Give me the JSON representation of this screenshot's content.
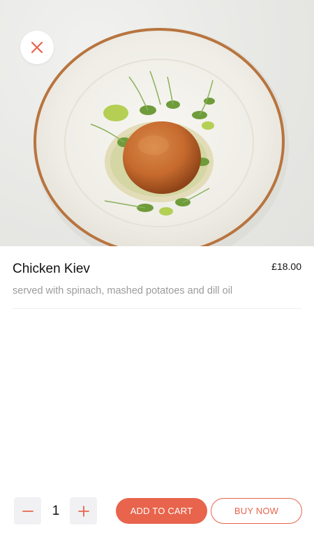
{
  "theme": {
    "accent": "#e8644c",
    "muted_text": "#9b9b9b",
    "stepper_bg": "#f1f1f3"
  },
  "header": {
    "close_icon": "close-icon",
    "image": "chicken-kiev-plate-image"
  },
  "product": {
    "name": "Chicken Kiev",
    "price": "£18.00",
    "description": "served with spinach, mashed potatoes and dill oil"
  },
  "cart": {
    "quantity": "1",
    "minus_icon": "minus-icon",
    "plus_icon": "plus-icon",
    "add_to_cart_label": "ADD TO CART",
    "buy_now_label": "BUY NOW"
  }
}
